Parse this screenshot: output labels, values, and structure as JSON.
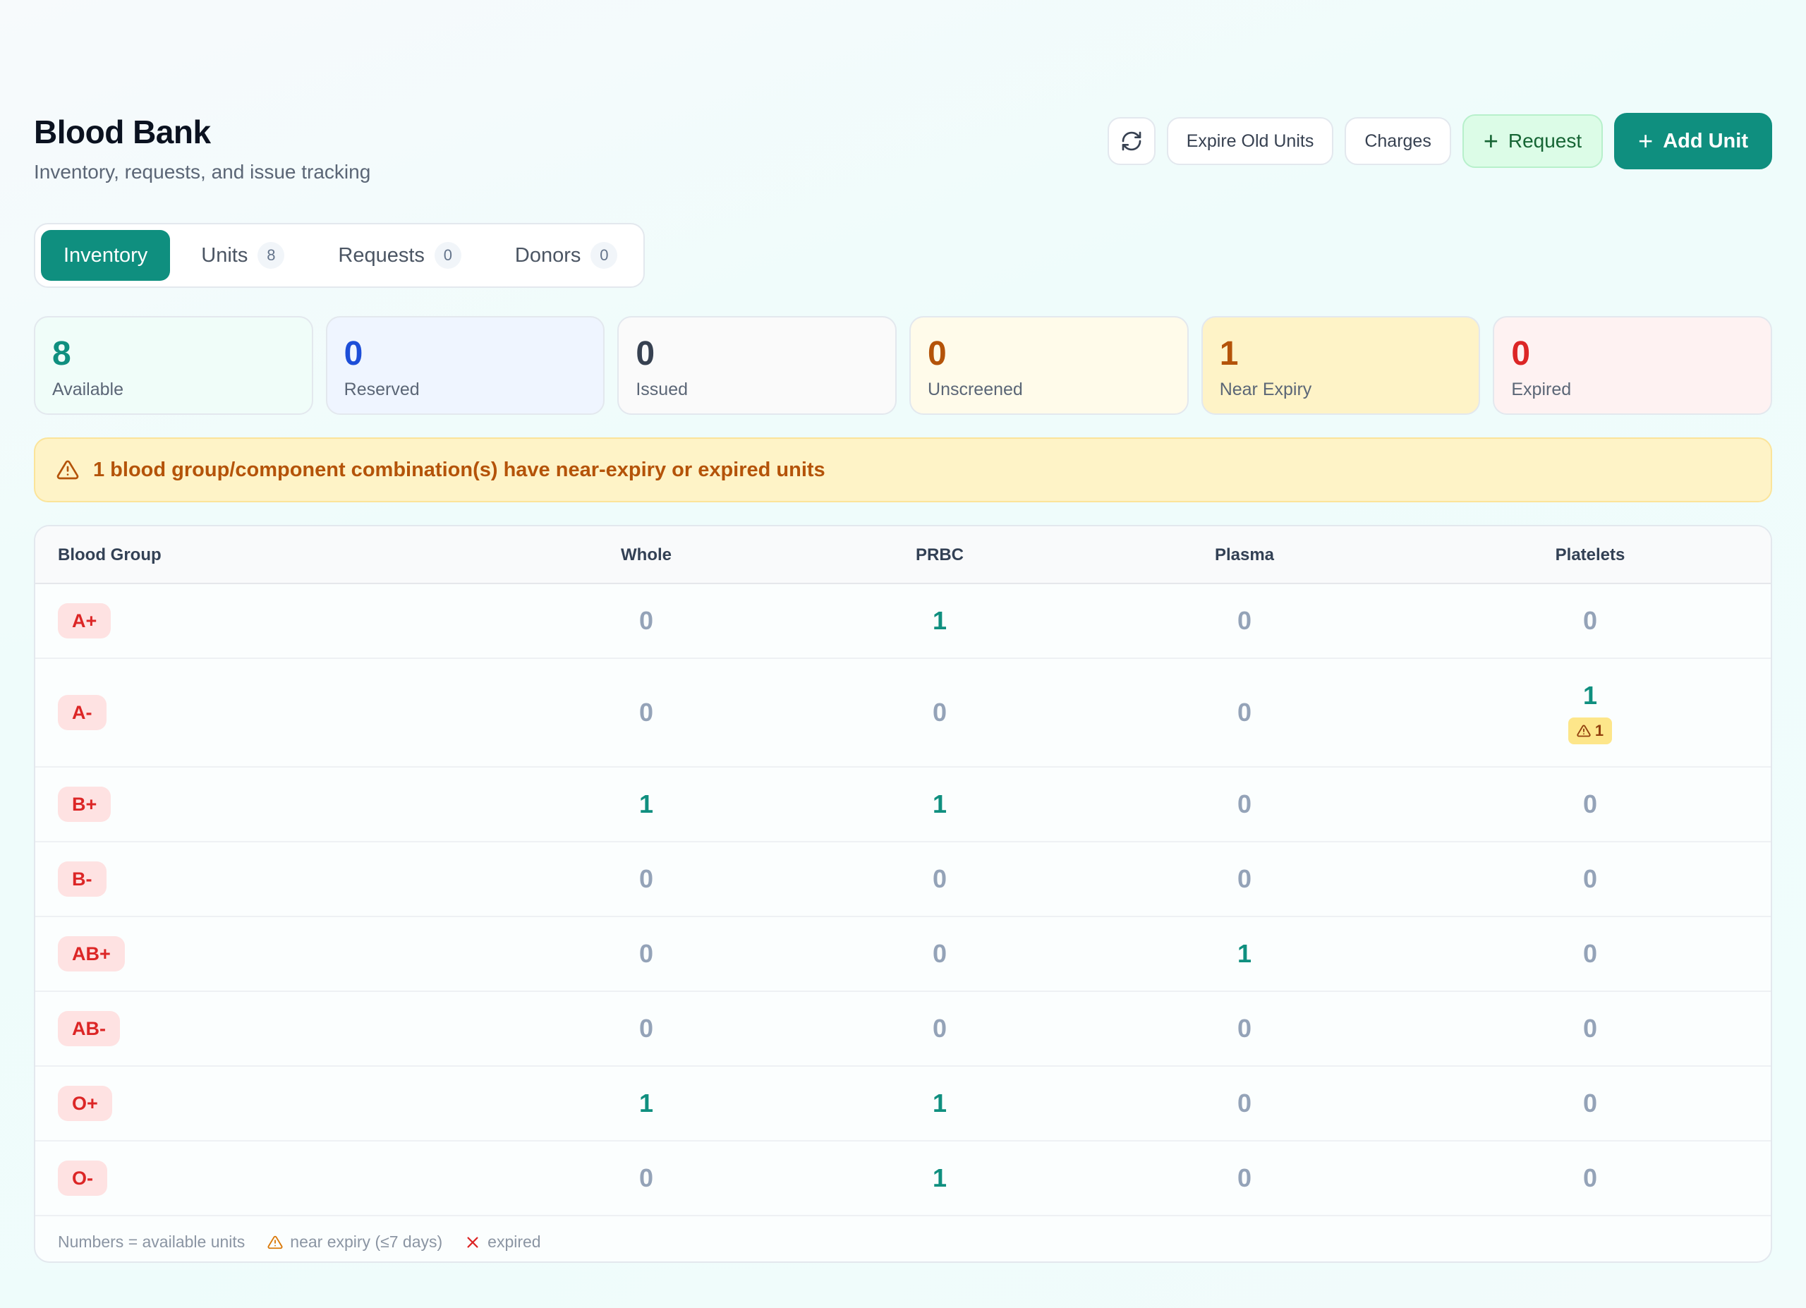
{
  "header": {
    "title": "Blood Bank",
    "subtitle": "Inventory, requests, and issue tracking",
    "actions": {
      "refresh_icon": "refresh-icon",
      "expire_label": "Expire Old Units",
      "charges_label": "Charges",
      "request_label": "Request",
      "add_unit_label": "Add Unit"
    }
  },
  "tabs": [
    {
      "label": "Inventory",
      "active": true
    },
    {
      "label": "Units",
      "count": "8"
    },
    {
      "label": "Requests",
      "count": "0"
    },
    {
      "label": "Donors",
      "count": "0"
    }
  ],
  "stats": [
    {
      "value": "8",
      "label": "Available",
      "color": "#0f8f7f",
      "bg": "#f0fdf9"
    },
    {
      "value": "0",
      "label": "Reserved",
      "color": "#1d4ed8",
      "bg": "#eff5ff"
    },
    {
      "value": "0",
      "label": "Issued",
      "color": "#374151",
      "bg": "#fafafa"
    },
    {
      "value": "0",
      "label": "Unscreened",
      "color": "#b45309",
      "bg": "#fffbea"
    },
    {
      "value": "1",
      "label": "Near Expiry",
      "color": "#b45309",
      "bg": "#fef3c7"
    },
    {
      "value": "0",
      "label": "Expired",
      "color": "#dc2626",
      "bg": "#fef2f2"
    }
  ],
  "alert": {
    "text": "1 blood group/component combination(s) have near-expiry or expired units"
  },
  "table": {
    "columns": [
      "Blood Group",
      "Whole",
      "PRBC",
      "Plasma",
      "Platelets"
    ],
    "rows": [
      {
        "group": "A+",
        "values": [
          "0",
          "1",
          "0",
          "0"
        ]
      },
      {
        "group": "A-",
        "values": [
          "0",
          "0",
          "0",
          "1"
        ],
        "near_expiry": {
          "col": 3,
          "count": "1"
        }
      },
      {
        "group": "B+",
        "values": [
          "1",
          "1",
          "0",
          "0"
        ]
      },
      {
        "group": "B-",
        "values": [
          "0",
          "0",
          "0",
          "0"
        ]
      },
      {
        "group": "AB+",
        "values": [
          "0",
          "0",
          "1",
          "0"
        ]
      },
      {
        "group": "AB-",
        "values": [
          "0",
          "0",
          "0",
          "0"
        ]
      },
      {
        "group": "O+",
        "values": [
          "1",
          "1",
          "0",
          "0"
        ]
      },
      {
        "group": "O-",
        "values": [
          "0",
          "1",
          "0",
          "0"
        ]
      }
    ]
  },
  "legend": {
    "numbers": "Numbers = available units",
    "near": "near expiry (≤7 days)",
    "expired": "expired"
  }
}
